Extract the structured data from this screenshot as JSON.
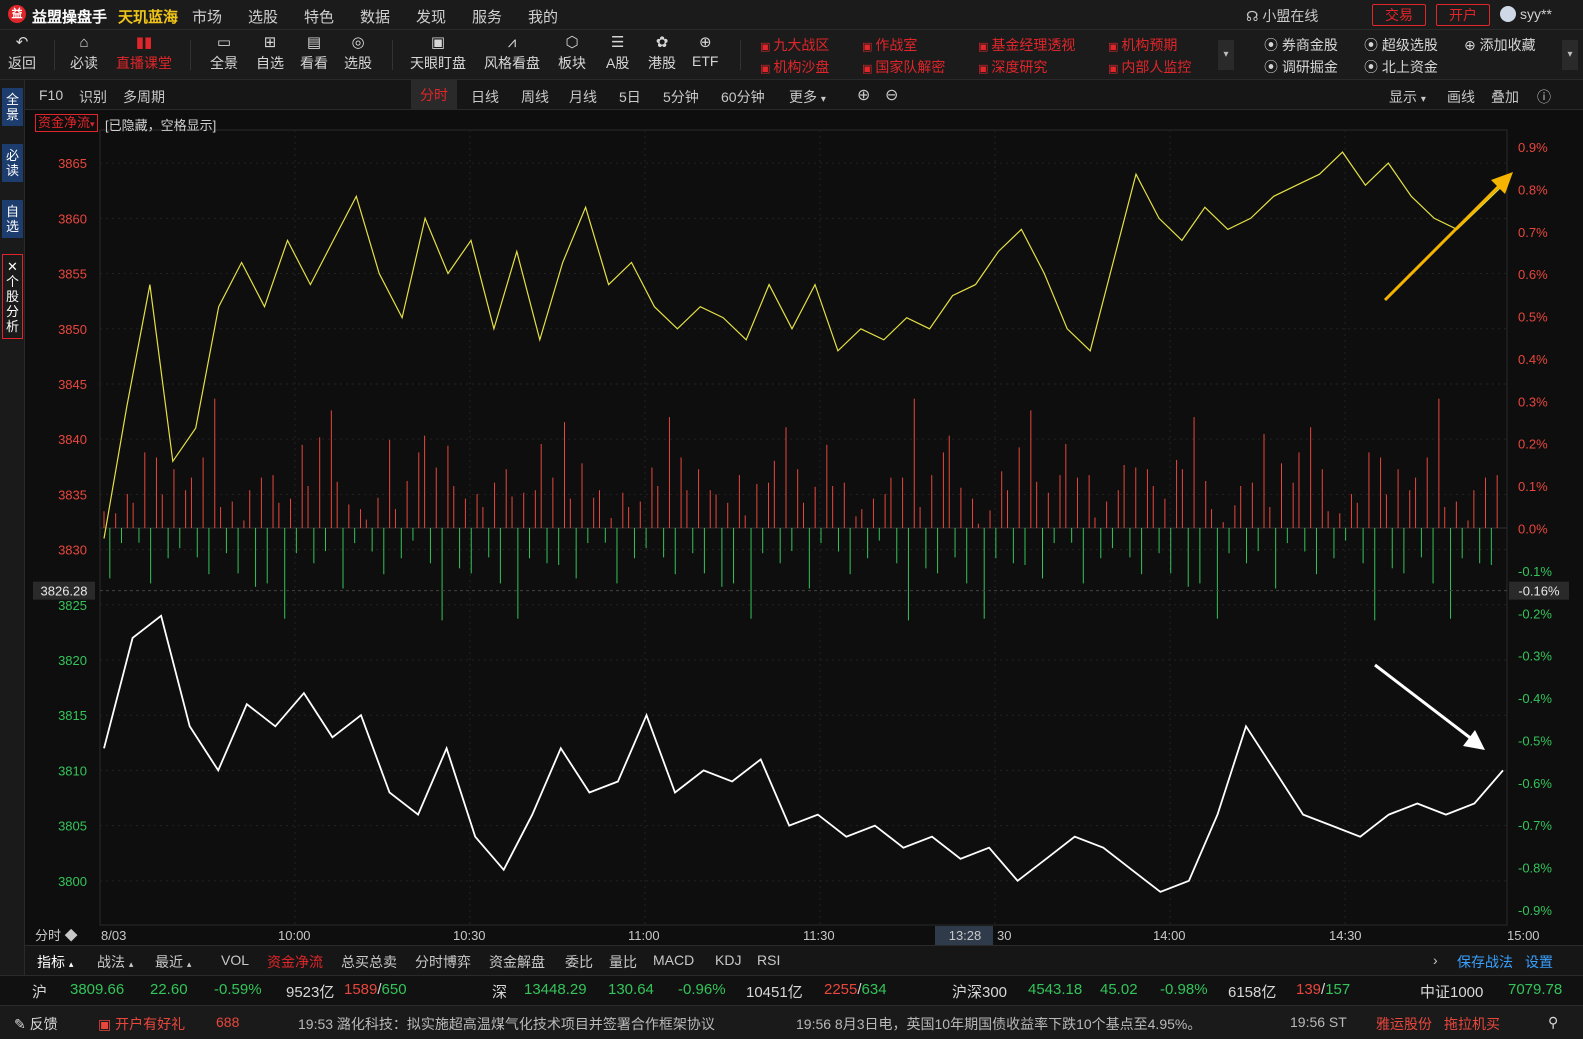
{
  "titlebar": {
    "app_name": "益盟操盘手",
    "sub_name": "天玑蓝海",
    "menu": [
      "市场",
      "选股",
      "特色",
      "数据",
      "发现",
      "服务",
      "我的"
    ],
    "online": "小盟在线",
    "trade": "交易",
    "open_account": "开户",
    "user": "syy**"
  },
  "toolbar": {
    "back": "返回",
    "must_read": "必读",
    "live_class": "直播课堂",
    "full_view": "全景",
    "watchlist": "自选",
    "look": "看看",
    "pick": "选股",
    "eye": "天眼盯盘",
    "style": "风格看盘",
    "sector": "板块",
    "a_share": "A股",
    "hk": "港股",
    "etf": "ETF",
    "red_links": [
      "九大战区",
      "作战室",
      "基金经理透视",
      "机构预期",
      "机构沙盘",
      "国家队解密",
      "深度研究",
      "内部人监控"
    ],
    "white_links": [
      "券商金股",
      "超级选股",
      "添加收藏",
      "调研掘金",
      "北上资金"
    ]
  },
  "leftstrip": [
    "全景",
    "必读",
    "自选",
    "个股分析"
  ],
  "periodbar": {
    "left": [
      "F10",
      "识别",
      "多周期"
    ],
    "periods": [
      "分时",
      "日线",
      "周线",
      "月线",
      "5日",
      "5分钟",
      "60分钟",
      "更多"
    ],
    "active": "分时",
    "right": [
      "显示",
      "画线",
      "叠加"
    ]
  },
  "chart": {
    "indicator_tag": "资金净流",
    "hidden_note": "[已隐藏，空格显示]",
    "left_axis": [
      "3865",
      "3860",
      "3855",
      "3850",
      "3845",
      "3840",
      "3835",
      "3830",
      "3825",
      "3820",
      "3815",
      "3810",
      "3805",
      "3800"
    ],
    "right_axis": [
      "0.9%",
      "0.8%",
      "0.7%",
      "0.6%",
      "0.5%",
      "0.4%",
      "0.3%",
      "0.2%",
      "0.1%",
      "0.0%",
      "-0.1%",
      "-0.2%",
      "-0.3%",
      "-0.4%",
      "-0.5%",
      "-0.6%",
      "-0.7%",
      "-0.8%",
      "-0.9%"
    ],
    "prev_close": "3826.28",
    "prev_close_pct": "-0.16%",
    "time_labels": [
      "8/03",
      "10:00",
      "10:30",
      "11:00",
      "11:30",
      "13:28",
      "30",
      "14:00",
      "14:30",
      "15:00"
    ],
    "bottom_left": "分时",
    "colors": {
      "up": "#e8473d",
      "down": "#33c45a",
      "index_line": "#ffffff",
      "avg_line": "#e4e045",
      "arrow_yellow": "#f5b400",
      "arrow_white": "#ffffff"
    }
  },
  "chart_data": {
    "type": "line",
    "title": "",
    "ylabel": "",
    "ylim": [
      3796,
      3868
    ],
    "series": [
      {
        "values": [
          3831,
          3843,
          3854,
          3838,
          3841,
          3852,
          3856,
          3852,
          3858,
          3854,
          3858,
          3862,
          3855,
          3851,
          3860,
          3855,
          3858,
          3850,
          3857,
          3849,
          3856,
          3861,
          3854,
          3856,
          3852,
          3850,
          3852,
          3851,
          3849,
          3854,
          3850,
          3854,
          3848,
          3850,
          3849,
          3851,
          3850,
          3853,
          3854,
          3857,
          3859,
          3855,
          3850,
          3848,
          3856,
          3864,
          3860,
          3858,
          3861,
          3859,
          3860,
          3862,
          3863,
          3864,
          3866,
          3863,
          3865,
          3862,
          3860,
          3859,
          3861,
          3863
        ]
      },
      {
        "values": [
          3812,
          3822,
          3824,
          3814,
          3810,
          3816,
          3814,
          3817,
          3813,
          3815,
          3808,
          3806,
          3812,
          3804,
          3801,
          3806,
          3812,
          3808,
          3809,
          3815,
          3808,
          3810,
          3809,
          3811,
          3805,
          3806,
          3804,
          3805,
          3803,
          3804,
          3802,
          3803,
          3800,
          3802,
          3804,
          3803,
          3801,
          3799,
          3800,
          3806,
          3814,
          3810,
          3806,
          3805,
          3804,
          3806,
          3807,
          3806,
          3807,
          3810
        ]
      }
    ],
    "bars_up": [
      0.08,
      0.09,
      0.05,
      0.02,
      0.09,
      0.06,
      0.1,
      0.15,
      0.09,
      0.12,
      0.16,
      0.1,
      0.2,
      0.22,
      0.1,
      0.12,
      0.18,
      0.14,
      0.2,
      0.22,
      0.1
    ],
    "bars_down": [
      -0.1,
      -0.18,
      -0.08,
      -0.05,
      -0.12,
      -0.06,
      -0.2,
      -0.1,
      -0.12,
      -0.18,
      -0.05,
      -0.08,
      -0.12,
      -0.06,
      -0.1,
      -0.12
    ]
  },
  "indtabs": {
    "left": [
      "指标",
      "战法",
      "最近"
    ],
    "tabs": [
      "VOL",
      "资金净流",
      "总买总卖",
      "分时博弈",
      "资金解盘",
      "委比",
      "量比",
      "MACD",
      "KDJ",
      "RSI"
    ],
    "active": "资金净流",
    "right": [
      "保存战法",
      "设置"
    ]
  },
  "marketbar": {
    "sh_label": "沪",
    "sh_value": "3809.66",
    "sh_change": "22.60",
    "sh_pct": "-0.59%",
    "sh_amount": "9523亿",
    "sh_up": "1589",
    "sh_down": "650",
    "sz_label": "深",
    "sz_value": "13448.29",
    "sz_change": "130.64",
    "sz_pct": "-0.96%",
    "sz_amount": "10451亿",
    "sz_up": "2255",
    "sz_down": "634",
    "hs_label": "沪深300",
    "hs_value": "4543.18",
    "hs_change": "45.02",
    "hs_pct": "-0.98%",
    "hs_amount": "6158亿",
    "hs_up": "139",
    "hs_down": "157",
    "zz_label": "中证1000",
    "zz_value": "7079.78"
  },
  "newsbar": {
    "feedback": "反馈",
    "promo": "开户有好礼",
    "promo_num": "688",
    "news1": "19:53 潞化科技：拟实施超高温煤气化技术项目并签署合作框架协议",
    "news2": "19:56 8月3日电，英国10年期国债收益率下跌10个基点至4.95%。",
    "time": "19:56 ST",
    "stock": "雅运股份",
    "stock2": "拖拉机买"
  }
}
